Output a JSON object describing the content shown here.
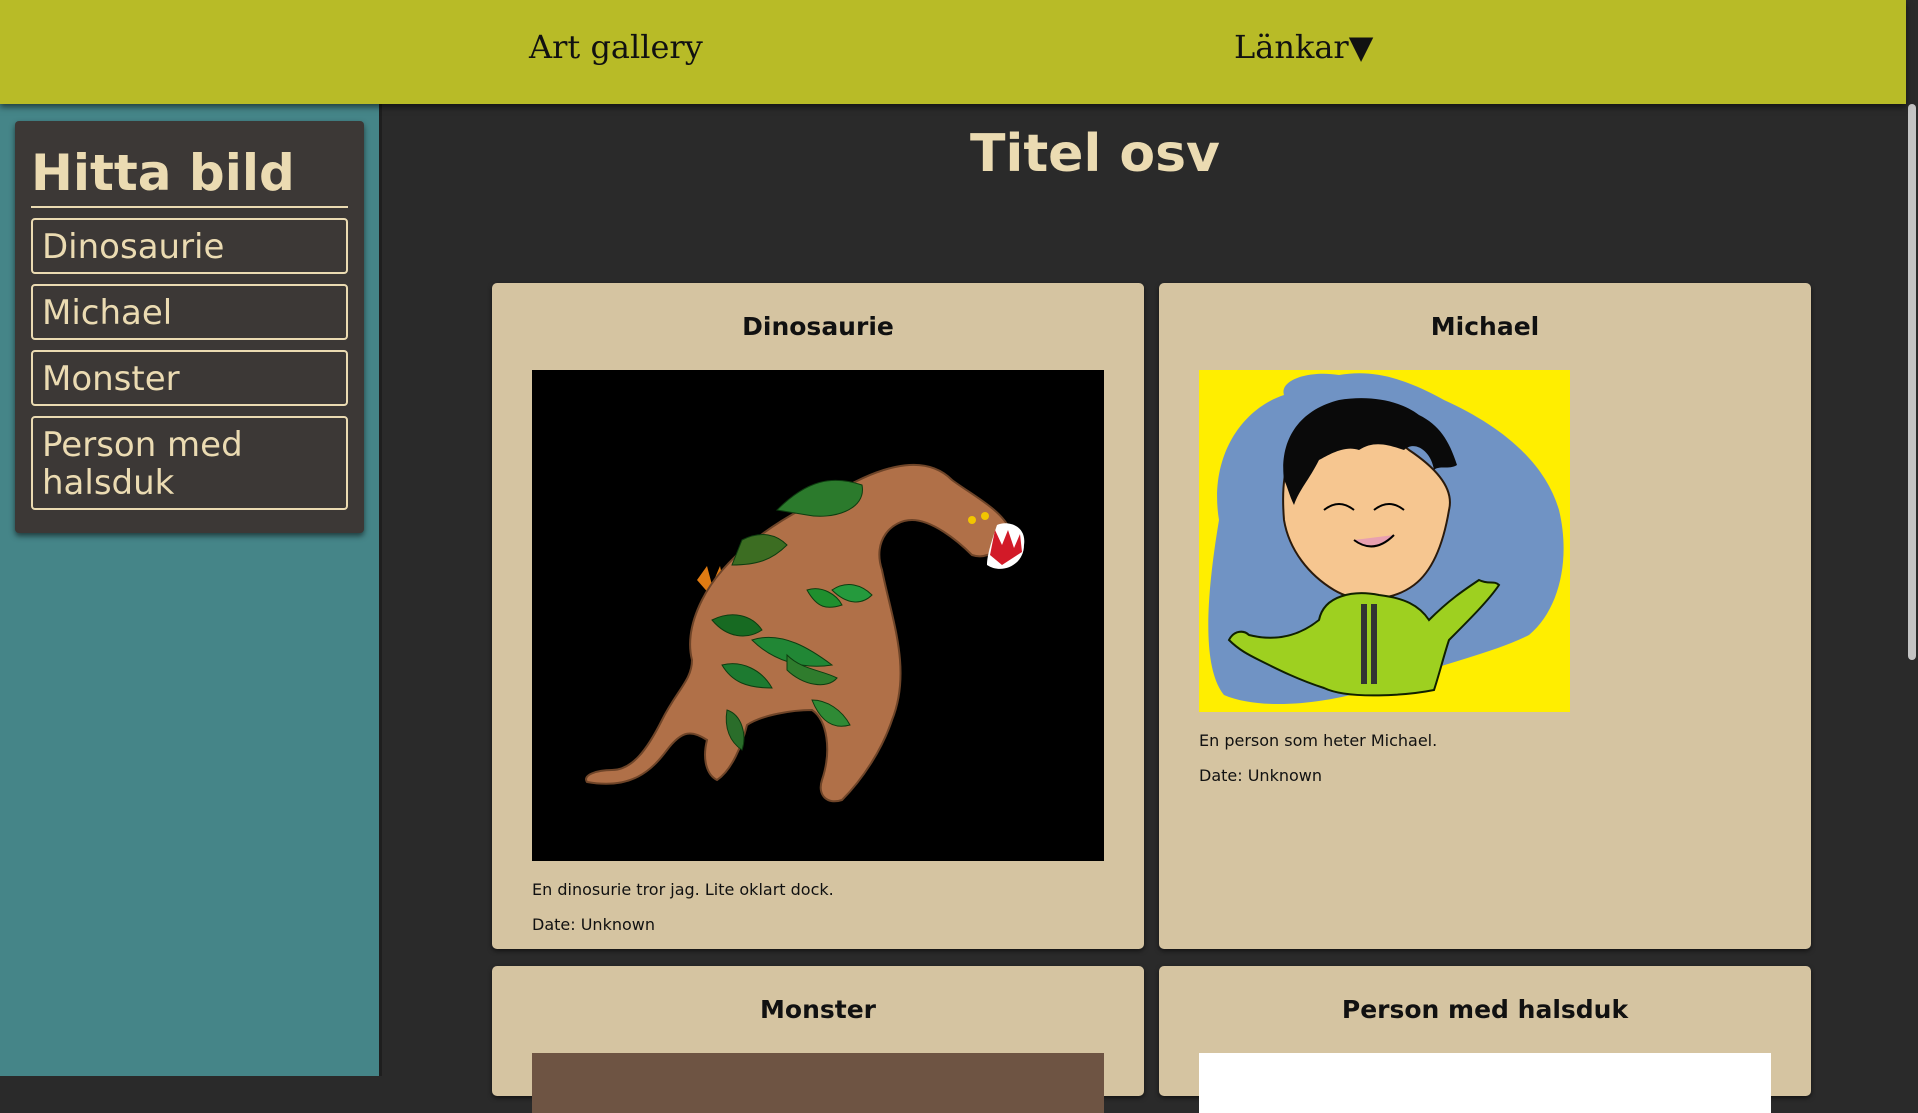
{
  "header": {
    "brand": "Art gallery",
    "links_label": "Länkar▼"
  },
  "sidebar": {
    "title": "Hitta bild",
    "items": [
      {
        "label": "Dinosaurie"
      },
      {
        "label": "Michael"
      },
      {
        "label": "Monster"
      },
      {
        "label": "Person med halsduk"
      }
    ]
  },
  "main": {
    "title": "Titel osv",
    "cards": [
      {
        "title": "Dinosaurie",
        "description": "En dinosurie tror jag. Lite oklart dock.",
        "date": "Date: Unknown"
      },
      {
        "title": "Michael",
        "description": "En person som heter Michael.",
        "date": "Date: Unknown"
      },
      {
        "title": "Monster"
      },
      {
        "title": "Person med halsduk"
      }
    ]
  },
  "colors": {
    "header": "#b8bb27",
    "sidebar": "#458588",
    "panel": "#3c3836",
    "main_bg": "#2a2a2a",
    "card": "#d5c4a1",
    "text_light": "#ebdbb2"
  }
}
